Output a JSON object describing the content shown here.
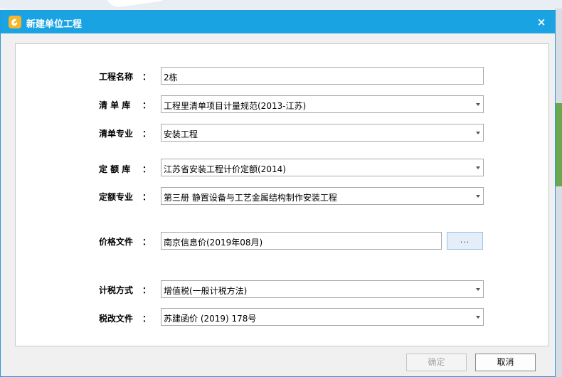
{
  "dialog": {
    "title": "新建单位工程",
    "close_glyph": "×"
  },
  "form": {
    "name": {
      "label": "工程名称",
      "colon": "：",
      "value": "2栋"
    },
    "list_lib": {
      "label": "清 单 库",
      "colon": "：",
      "value": "工程里清单项目计量规范(2013-江苏)"
    },
    "list_major": {
      "label": "清单专业",
      "colon": "：",
      "value": "安装工程"
    },
    "quota_lib": {
      "label": "定 额 库",
      "colon": "：",
      "value": "江苏省安装工程计价定额(2014)"
    },
    "quota_major": {
      "label": "定额专业",
      "colon": "：",
      "value": "第三册 静置设备与工艺金属结构制作安装工程"
    },
    "price_file": {
      "label": "价格文件",
      "colon": "：",
      "value": "南京信息价(2019年08月)",
      "browse": "..."
    },
    "tax_method": {
      "label": "计税方式",
      "colon": "：",
      "value": "增值税(一般计税方法)"
    },
    "tax_file": {
      "label": "税改文件",
      "colon": "：",
      "value": "苏建函价 (2019) 178号"
    }
  },
  "buttons": {
    "ok": "确定",
    "cancel": "取消"
  },
  "colors": {
    "titlebar": "#1aa3e3",
    "browse_button": "#e3eef8"
  }
}
